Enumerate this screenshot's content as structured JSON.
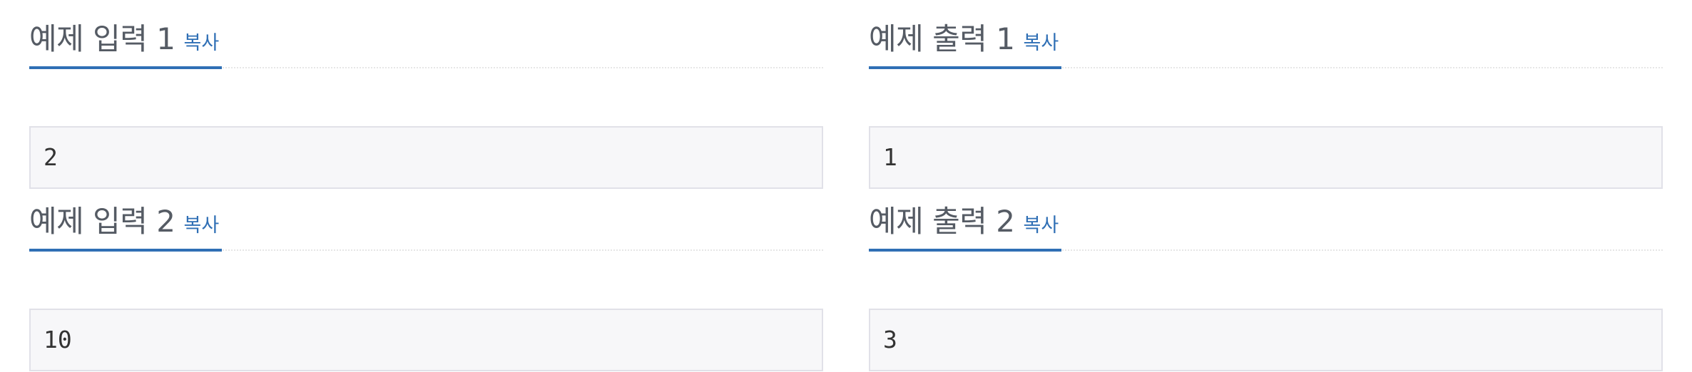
{
  "samples": [
    {
      "title": "예제 입력 1",
      "copy_label": "복사",
      "value": "2"
    },
    {
      "title": "예제 출력 1",
      "copy_label": "복사",
      "value": "1"
    },
    {
      "title": "예제 입력 2",
      "copy_label": "복사",
      "value": "10"
    },
    {
      "title": "예제 출력 2",
      "copy_label": "복사",
      "value": "3"
    }
  ],
  "colors": {
    "accent": "#2f6fb5",
    "title_text": "#555b64",
    "sample_bg": "#f7f7f9",
    "sample_border": "#e1e1e8"
  }
}
